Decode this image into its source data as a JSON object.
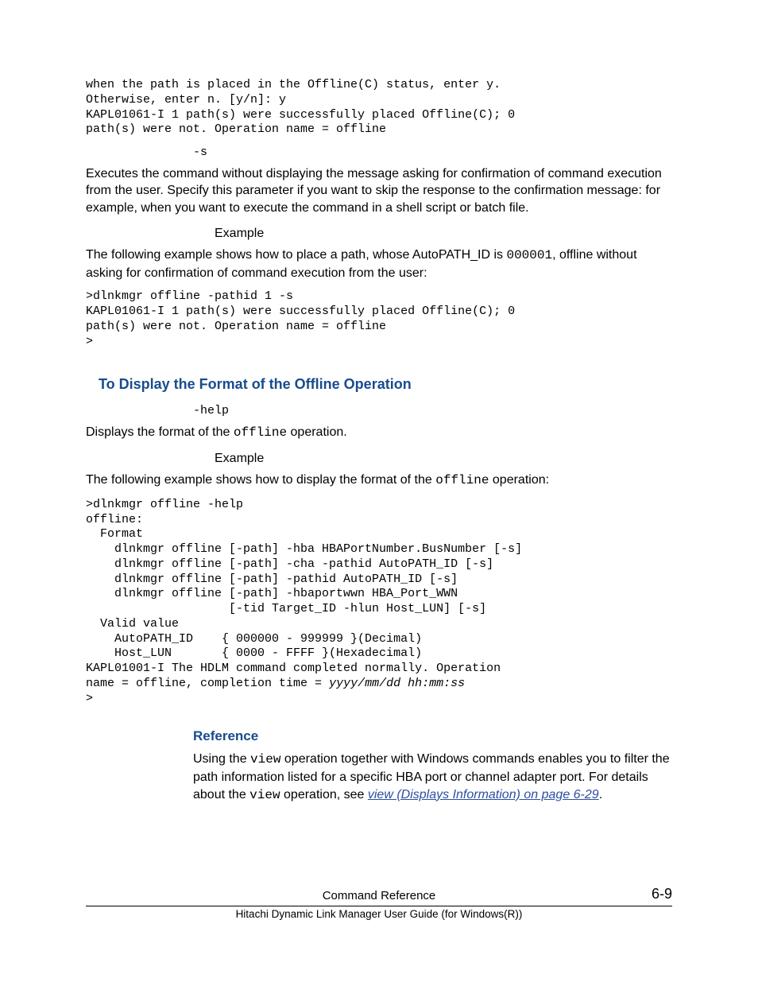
{
  "block1": {
    "code": "when the path is placed in the Offline(C) status, enter y.\nOtherwise, enter n. [y/n]: y\nKAPL01061-I 1 path(s) were successfully placed Offline(C); 0\npath(s) were not. Operation name = offline"
  },
  "param_s": {
    "label": "-s",
    "desc": "Executes the command without displaying the message asking for confirmation of command execution from the user. Specify this parameter if you want to skip the response to the confirmation message: for example, when you want to execute the command in a shell script or batch file.",
    "example_label": "Example",
    "example_intro_a": "The following example shows how to place a path, whose AutoPATH_ID is ",
    "example_intro_code": "000001",
    "example_intro_b": ", offline without asking for confirmation of command execution from the user:",
    "code": ">dlnkmgr offline -pathid 1 -s\nKAPL01061-I 1 path(s) were successfully placed Offline(C); 0\npath(s) were not. Operation name = offline\n>"
  },
  "heading_format": "To Display the Format of the Offline Operation",
  "param_help": {
    "label": "-help",
    "desc_a": "Displays the format of the ",
    "desc_code": "offline",
    "desc_b": " operation.",
    "example_label": "Example",
    "example_intro_a": "The following example shows how to display the format of the ",
    "example_intro_code": "offline",
    "example_intro_b": " operation:",
    "code_pre": ">dlnkmgr offline -help\noffline:\n  Format\n    dlnkmgr offline [-path] -hba HBAPortNumber.BusNumber [-s]\n    dlnkmgr offline [-path] -cha -pathid AutoPATH_ID [-s]\n    dlnkmgr offline [-path] -pathid AutoPATH_ID [-s]\n    dlnkmgr offline [-path] -hbaportwwn HBA_Port_WWN\n                    [-tid Target_ID -hlun Host_LUN] [-s]\n  Valid value\n    AutoPATH_ID    { 000000 - 999999 }(Decimal)\n    Host_LUN       { 0000 - FFFF }(Hexadecimal)\nKAPL01001-I The HDLM command completed normally. Operation\nname = offline, completion time = ",
    "code_time": "yyyy/mm/dd hh:mm:ss",
    "code_post": "\n>"
  },
  "heading_reference": "Reference",
  "reference": {
    "a": "Using the ",
    "code1": "view",
    "b": " operation together with Windows commands enables you to filter the path information listed for a specific HBA port or channel adapter port. For details about the ",
    "code2": "view",
    "c": " operation, see ",
    "link": "view (Displays Information) on page 6-29",
    "d": "."
  },
  "footer": {
    "title": "Command Reference",
    "page": "6-9",
    "sub": "Hitachi Dynamic Link Manager User Guide (for Windows(R))"
  }
}
